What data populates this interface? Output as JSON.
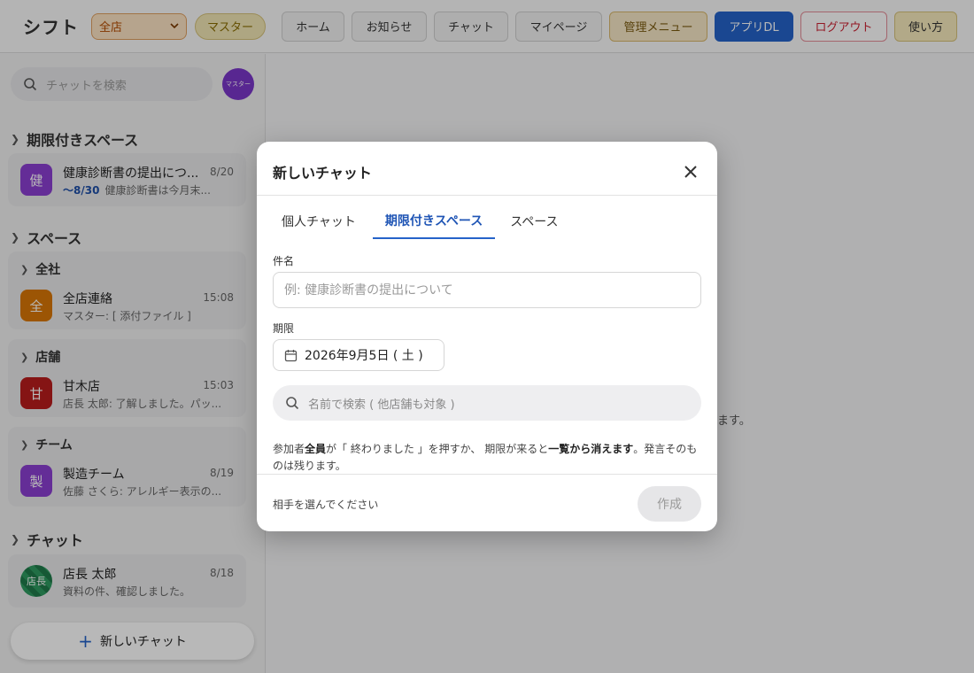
{
  "header": {
    "logo": "シフト",
    "store_select": "全店",
    "role_badge": "マスター",
    "nav": {
      "home": "ホーム",
      "news": "お知らせ",
      "chat": "チャット",
      "mypage": "マイページ",
      "admin": "管理メニュー",
      "app_dl": "アプリDL",
      "logout": "ログアウト",
      "help": "使い方"
    }
  },
  "sidebar": {
    "search_placeholder": "チャットを検索",
    "avatar_label": "マスター",
    "sections": {
      "deadline": {
        "title": "期限付きスペース",
        "room": {
          "icon": "健",
          "name": "健康診断書の提出につ...",
          "time": "8/20",
          "deadline": "〜8/30",
          "preview": "健康診断書は今月末..."
        }
      },
      "spaces": {
        "title": "スペース",
        "groups": [
          {
            "title": "全社",
            "room": {
              "icon": "全",
              "name": "全店連絡",
              "time": "15:08",
              "preview": "マスター: [ 添付ファイル ]"
            }
          },
          {
            "title": "店舗",
            "room": {
              "icon": "甘",
              "name": "甘木店",
              "time": "15:03",
              "preview": "店長 太郎: 了解しました。パッ..."
            }
          },
          {
            "title": "チーム",
            "room": {
              "icon": "製",
              "name": "製造チーム",
              "time": "8/19",
              "preview": "佐藤 さくら: アレルギー表示の..."
            }
          }
        ]
      },
      "chat": {
        "title": "チャット",
        "room": {
          "icon": "店長",
          "name": "店長 太郎",
          "time": "8/18",
          "preview": "資料の件、確認しました。"
        }
      }
    },
    "new_chat_label": "新しいチャット"
  },
  "main": {
    "hint_tail": "ます。"
  },
  "modal": {
    "title": "新しいチャット",
    "tabs": [
      "個人チャット",
      "期限付きスペース",
      "スペース"
    ],
    "subject_label": "件名",
    "subject_placeholder": "例: 健康診断書の提出について",
    "deadline_label": "期限",
    "deadline_value": "2026年9月5日 ( 土 )",
    "member_search_placeholder": "名前で検索 ( 他店舗も対象 )",
    "note_line1_prefix": "参加者",
    "note_line1_bold": "全員",
    "note_line1_mid": "が「 終わりました 」を押すか、 期限が来ると",
    "note_line1_bold2": "一覧から消えます",
    "note_line1_suffix": "。発言そのものは残ります。",
    "footer_hint": "相手を選んでください",
    "create_label": "作成"
  },
  "colors": {
    "accent": "#2563c9",
    "logout": "#cc2233",
    "deadline_icon": "#8b3fd1",
    "company_icon": "#d97706",
    "store_icon": "#b91c1c",
    "team_icon": "#8b3fd1",
    "chat_icon": "#1f7a4a"
  }
}
